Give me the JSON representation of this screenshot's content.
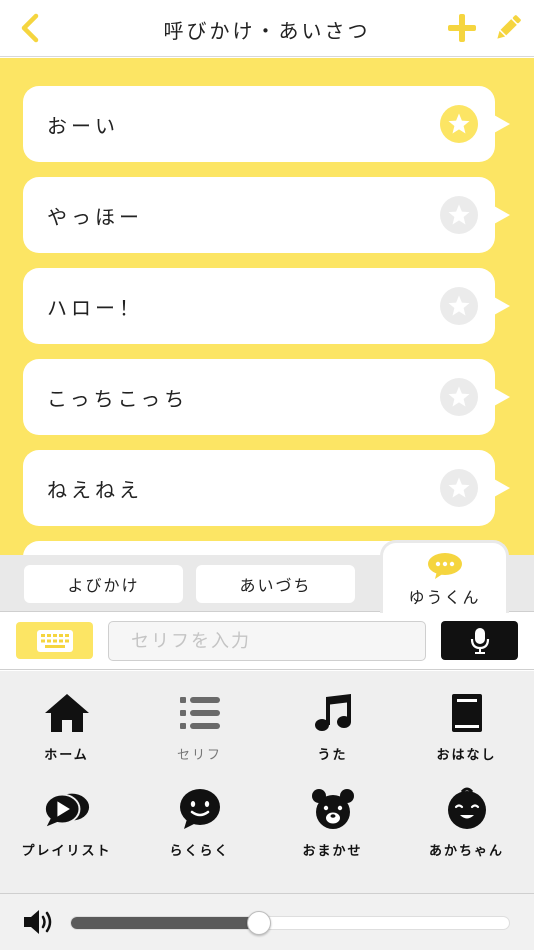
{
  "header": {
    "title": "呼びかけ・あいさつ",
    "back_icon": "chevron-left-icon",
    "add_icon": "plus-icon",
    "edit_icon": "pencil-icon"
  },
  "colors": {
    "accent": "#fce564",
    "accent_icon": "#f5d53f",
    "dark": "#111111"
  },
  "phrases": [
    {
      "text": "おーい",
      "favorite": true
    },
    {
      "text": "やっほー",
      "favorite": false
    },
    {
      "text": "ハロー！",
      "favorite": false
    },
    {
      "text": "こっちこっち",
      "favorite": false
    },
    {
      "text": "ねえねえ",
      "favorite": false
    }
  ],
  "tabs": {
    "items": [
      {
        "label": "よびかけ"
      },
      {
        "label": "あいづち"
      }
    ],
    "active": {
      "label": "ゆうくん",
      "icon": "chat-bubble-icon"
    }
  },
  "input": {
    "placeholder": "セリフを入力",
    "keyboard_icon": "keyboard-icon",
    "mic_icon": "microphone-icon"
  },
  "menu": [
    {
      "label": "ホーム",
      "icon": "home-icon"
    },
    {
      "label": "セリフ",
      "icon": "list-icon"
    },
    {
      "label": "うた",
      "icon": "music-note-icon"
    },
    {
      "label": "おはなし",
      "icon": "book-icon"
    },
    {
      "label": "プレイリスト",
      "icon": "playlist-icon"
    },
    {
      "label": "らくらく",
      "icon": "smile-face-icon"
    },
    {
      "label": "おまかせ",
      "icon": "bear-icon"
    },
    {
      "label": "あかちゃん",
      "icon": "baby-face-icon"
    }
  ],
  "volume": {
    "level": 0.43,
    "icon": "speaker-icon"
  }
}
